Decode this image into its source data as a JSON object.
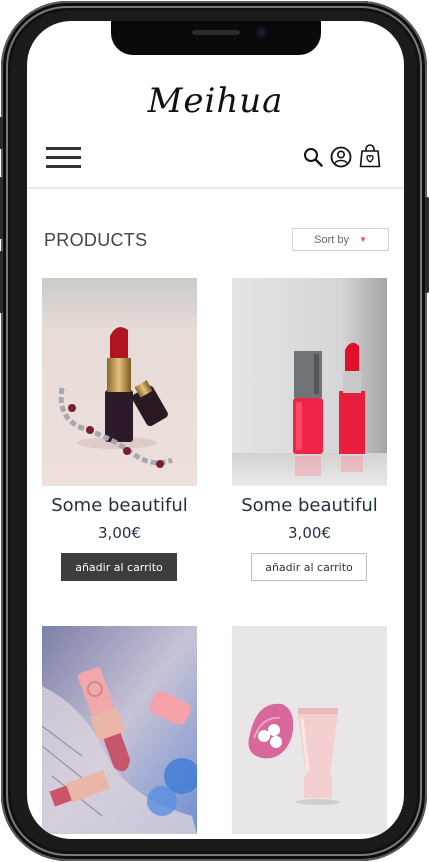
{
  "brand": {
    "logo": "Meihua"
  },
  "header": {
    "menu_icon": "hamburger-menu-icon",
    "search_icon": "search-icon",
    "account_icon": "user-account-icon",
    "cart_icon": "shopping-bag-icon"
  },
  "catalog": {
    "title": "PRODUCTS",
    "sort_label": "Sort by",
    "sort_icon": "chevron-down-icon"
  },
  "products": [
    {
      "name": "Some beautiful",
      "price": "3,00€",
      "button": "añadir al carrito",
      "button_style": "dark"
    },
    {
      "name": "Some beautiful",
      "price": "3,00€",
      "button": "añadir al carrito",
      "button_style": "light"
    },
    {
      "name": "",
      "price": "",
      "button": ""
    },
    {
      "name": "",
      "price": "",
      "button": ""
    }
  ],
  "colors": {
    "text_dark": "#1f3140",
    "button_dark": "#3d3d3d",
    "accent_pink": "#e0567a",
    "divider": "#e3eaea"
  }
}
